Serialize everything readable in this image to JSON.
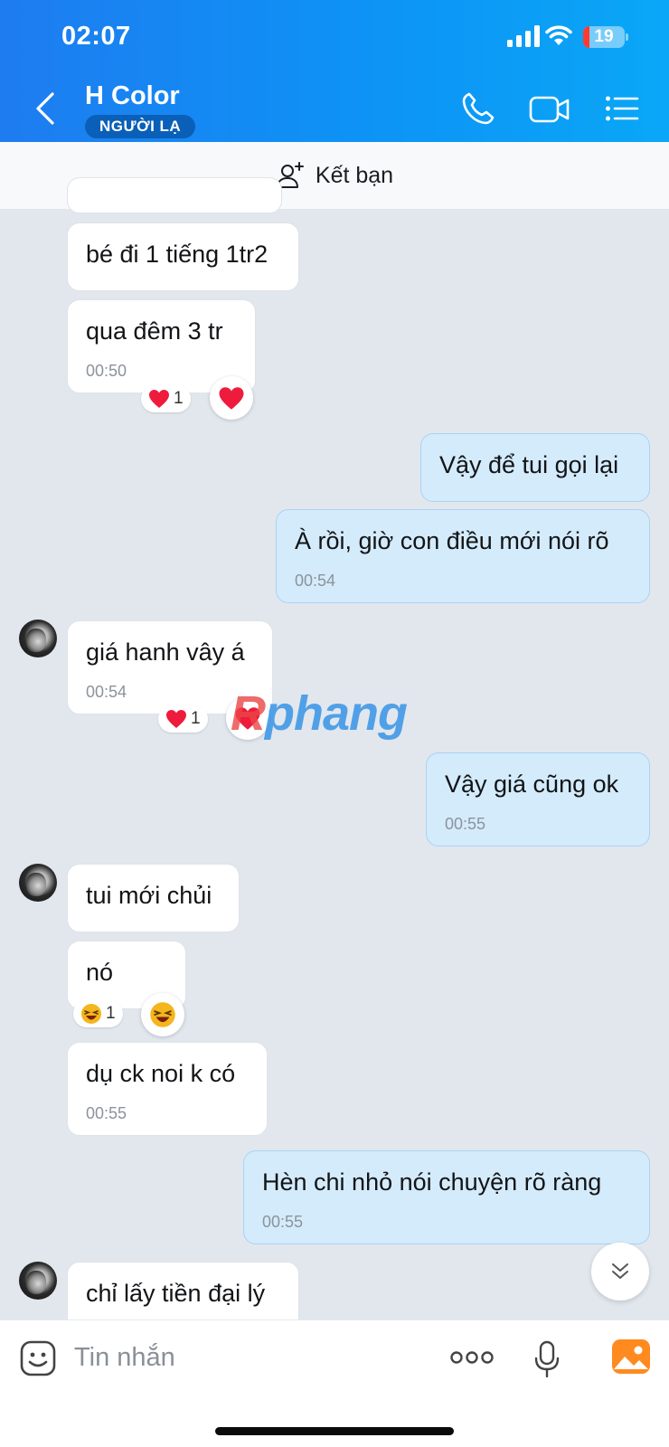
{
  "status_bar": {
    "time": "02:07",
    "battery": "19"
  },
  "header": {
    "contact_name": "H Color",
    "badge": "NGƯỜI LẠ"
  },
  "friend_bar": {
    "label": "Kết bạn"
  },
  "messages": [
    {
      "text": "bé đi 1 tiếng 1tr2",
      "time": ""
    },
    {
      "text": "qua đêm 3 tr",
      "time": "00:50",
      "reaction_count": "1"
    },
    {
      "text": "Vậy để tui gọi lại",
      "time": ""
    },
    {
      "text": "À rồi, giờ con điều mới nói rõ",
      "time": "00:54"
    },
    {
      "text": "giá hanh vây á",
      "time": "00:54",
      "reaction_count": "1"
    },
    {
      "text": "Vậy giá cũng ok",
      "time": "00:55"
    },
    {
      "text": "tui mới chủi",
      "time": ""
    },
    {
      "text": "nó",
      "time": "",
      "reaction_count": "1"
    },
    {
      "text": "dụ ck noi k có",
      "time": "00:55"
    },
    {
      "text": "Hèn chi nhỏ nói chuyện rõ ràng",
      "time": "00:55"
    },
    {
      "text": "chỉ lấy tiền đại lý",
      "time": ""
    }
  ],
  "watermark": {
    "prefix": "R",
    "text": "phang"
  },
  "composer": {
    "placeholder": "Tin nhắn"
  },
  "colors": {
    "header_start": "#1e7cf0",
    "header_end": "#0aa7f7",
    "outgoing_bubble": "#d4ebfb",
    "incoming_bubble": "#ffffff",
    "chat_bg": "#e2e7ee"
  },
  "icons": [
    "back-icon",
    "phone-icon",
    "video-call-icon",
    "list-menu-icon",
    "add-friend-icon",
    "heart-icon",
    "laughing-emoji-icon",
    "chevron-down-icon",
    "sticker-icon",
    "more-dots-icon",
    "microphone-icon",
    "image-icon"
  ]
}
